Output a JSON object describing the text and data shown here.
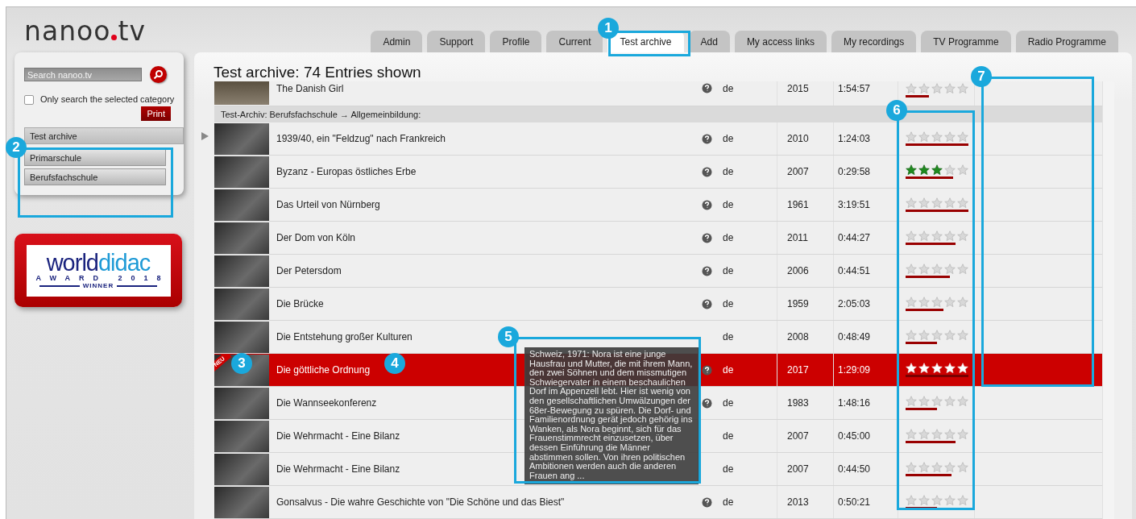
{
  "logo": {
    "text": "nanoo",
    "suffix": "tv"
  },
  "tabs": [
    {
      "label": "Admin",
      "selected": false
    },
    {
      "label": "Support",
      "selected": false
    },
    {
      "label": "Profile",
      "selected": false
    },
    {
      "label": "Current",
      "selected": false
    },
    {
      "label": "Test archive",
      "selected": true
    },
    {
      "label": "Add",
      "selected": false
    },
    {
      "label": "My access links",
      "selected": false
    },
    {
      "label": "My recordings",
      "selected": false
    },
    {
      "label": "TV Programme",
      "selected": false
    },
    {
      "label": "Radio Programme",
      "selected": false
    }
  ],
  "sidebar": {
    "search": {
      "placeholder": "Search nanoo.tv"
    },
    "only_selected": {
      "label": "Only search the selected category",
      "checked": false
    },
    "print": "Print",
    "categories": [
      {
        "label": "Test archive",
        "selected": true
      },
      {
        "label": "Primarschule",
        "selected": false
      },
      {
        "label": "Berufsfachschule",
        "selected": false
      }
    ]
  },
  "award": {
    "brand_a": "world",
    "brand_b": "didac",
    "line": "AWARD 2018",
    "winner": "WINNER"
  },
  "title": "Test archive: 74 Entries shown",
  "partial_row": {
    "title": "The Danish Girl",
    "info": true,
    "lang": "de",
    "year": "2015",
    "duration": "1:54:57",
    "stars": 0,
    "level": 0.37
  },
  "group_header": "Test-Archiv: Berufsfachschule → Allgemeinbildung:",
  "rows": [
    {
      "title": "1939/40, ein \"Feldzug\" nach Frankreich",
      "info": true,
      "lang": "de",
      "year": "2010",
      "duration": "1:24:03",
      "stars": 0,
      "level": 1,
      "selected": false
    },
    {
      "title": "Byzanz - Europas östliches Erbe",
      "info": true,
      "lang": "de",
      "year": "2007",
      "duration": "0:29:58",
      "stars": 3,
      "level": 0.75,
      "selected": false
    },
    {
      "title": "Das Urteil von Nürnberg",
      "info": true,
      "lang": "de",
      "year": "1961",
      "duration": "3:19:51",
      "stars": 0,
      "level": 1,
      "selected": false
    },
    {
      "title": "Der Dom von Köln",
      "info": true,
      "lang": "de",
      "year": "2011",
      "duration": "0:44:27",
      "stars": 0,
      "level": 0.8,
      "selected": false
    },
    {
      "title": "Der Petersdom",
      "info": true,
      "lang": "de",
      "year": "2006",
      "duration": "0:44:51",
      "stars": 0,
      "level": 0.7,
      "selected": false
    },
    {
      "title": "Die Brücke",
      "info": true,
      "lang": "de",
      "year": "1959",
      "duration": "2:05:03",
      "stars": 0,
      "level": 0.6,
      "selected": false
    },
    {
      "title": "Die Entstehung großer Kulturen",
      "info": false,
      "lang": "de",
      "year": "2008",
      "duration": "0:48:49",
      "stars": 0,
      "level": 0.5,
      "selected": false
    },
    {
      "title": "Die göttliche Ordnung",
      "info": true,
      "lang": "de",
      "year": "2017",
      "duration": "1:29:09",
      "stars": 5,
      "level": 1,
      "selected": true,
      "new_label": "NEU"
    },
    {
      "title": "Die Wannseekonferenz",
      "info": true,
      "lang": "de",
      "year": "1983",
      "duration": "1:48:16",
      "stars": 0,
      "level": 0.5,
      "selected": false
    },
    {
      "title": "Die Wehrmacht - Eine Bilanz",
      "info": false,
      "lang": "de",
      "year": "2007",
      "duration": "0:45:00",
      "stars": 0,
      "level": 0.8,
      "selected": false
    },
    {
      "title": "Die Wehrmacht - Eine Bilanz",
      "info": false,
      "lang": "de",
      "year": "2007",
      "duration": "0:44:50",
      "stars": 0,
      "level": 0.73,
      "selected": false
    },
    {
      "title": "Gonsalvus - Die wahre Geschichte von \"Die Schöne und das Biest\"",
      "info": true,
      "lang": "de",
      "year": "2013",
      "duration": "0:50:21",
      "stars": 0,
      "level": 0.5,
      "selected": false
    }
  ],
  "tooltip": "Schweiz, 1971: Nora ist eine junge Hausfrau und Mutter, die mit ihrem Mann, den zwei Söhnen und dem missmutigen Schwiegervater in einem beschaulichen Dorf im Appenzell lebt. Hier ist wenig von den gesellschaftlichen Umwälzungen der 68er-Bewegung zu spüren. Die Dorf- und Familienordnung gerät jedoch gehörig ins Wanken, als Nora beginnt, sich für das Frauenstimmrecht einzusetzen, über dessen Einführung die Männer abstimmen sollen. Von ihren politischen Ambitionen werden auch die anderen Frauen ang ...",
  "callouts": [
    {
      "label": "1"
    },
    {
      "label": "2"
    },
    {
      "label": "3"
    },
    {
      "label": "4"
    },
    {
      "label": "5"
    },
    {
      "label": "6"
    },
    {
      "label": "7"
    }
  ]
}
